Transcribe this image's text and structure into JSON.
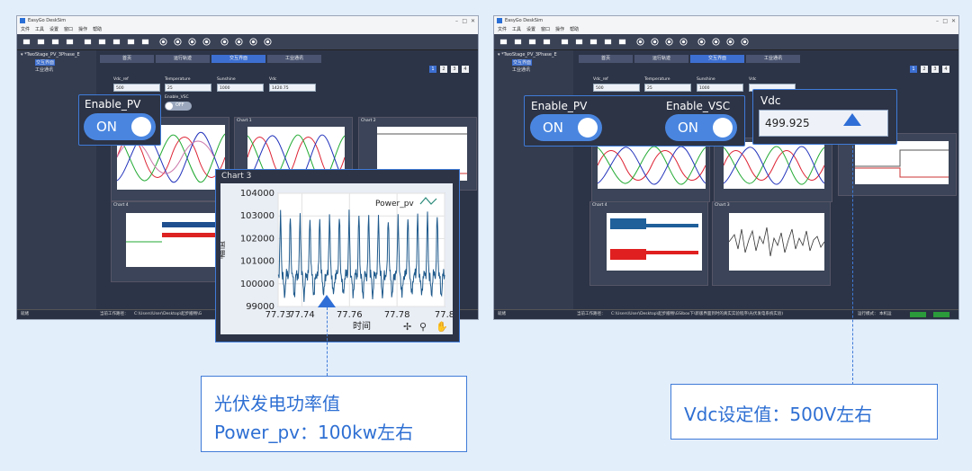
{
  "app": {
    "title": "EasyGo DeskSim",
    "menus": [
      "文件",
      "工具",
      "设置",
      "窗口",
      "操作",
      "帮助"
    ]
  },
  "left": {
    "project": "*TwoStage_PV_3Phase_E",
    "tree_children": [
      "交互界面",
      "工业通讯"
    ],
    "tabs": [
      {
        "label": "首页"
      },
      {
        "label": "运行轨迹"
      },
      {
        "label": "交互界面"
      },
      {
        "label": "工业通讯"
      }
    ],
    "pages": [
      "1",
      "2",
      "3",
      "4"
    ],
    "fields": [
      {
        "label": "Vdc_ref",
        "value": "500"
      },
      {
        "label": "Temperature",
        "value": "25"
      },
      {
        "label": "Sunshine",
        "value": "1000"
      },
      {
        "label": "Vdc",
        "value": "1420.75"
      }
    ],
    "enable_vsc_label": "Enable_VSC",
    "enable_vsc_state": "OFF",
    "chart_titles": [
      "Chart 1",
      "Chart 2",
      "Chart 4"
    ],
    "status_left": "就绪",
    "status_path_label": "当前工作路径：",
    "status_path": "C:\\Users\\User\\Desktop\\起步搬畅\\G"
  },
  "right": {
    "project": "*TwoStage_PV_3Phase_E",
    "tree_children": [
      "交互界面",
      "工业通讯"
    ],
    "tabs": [
      {
        "label": "首页"
      },
      {
        "label": "运行轨迹"
      },
      {
        "label": "交互界面"
      },
      {
        "label": "工业通讯"
      }
    ],
    "pages": [
      "1",
      "2",
      "3",
      "4"
    ],
    "fields": [
      {
        "label": "Vdc_ref",
        "value": "500"
      },
      {
        "label": "Temperature",
        "value": "25"
      },
      {
        "label": "Sunshine",
        "value": "1000"
      },
      {
        "label": "Vdc",
        "value": ""
      }
    ],
    "chart_titles": [
      "Chart 4",
      "Chart 3"
    ],
    "status_left": "就绪",
    "status_path_label": "当前工作路径：",
    "status_path": "C:\\Users\\User\\Desktop\\起步搬畅\\GSlbox下\\新版界面到时的真实实验程序\\光伏发电系统实验)",
    "status_mode": "运行模式：",
    "status_mode_value": "本机运",
    "status_ok1": "",
    "status_ok2": ""
  },
  "callouts": {
    "enable_pv_label": "Enable_PV",
    "enable_pv_state": "ON",
    "enable_vsc_label": "Enable_VSC",
    "enable_vsc_state": "ON",
    "vdc_label": "Vdc",
    "vdc_value": "499.925"
  },
  "notes": {
    "left_line1": "光伏发电功率值",
    "left_line2": "Power_pv：100kw左右",
    "right_line1": "Vdc设定值：500V左右"
  },
  "chart_data": {
    "type": "line",
    "title": "Chart 3",
    "xlabel": "时间",
    "ylabel": "幅值",
    "series": [
      {
        "name": "Power_pv"
      }
    ],
    "x_ticks": [
      "77.73",
      "77.74",
      "77.76",
      "77.78",
      "77.8"
    ],
    "y_ticks": [
      "99000",
      "100000",
      "101000",
      "102000",
      "103000",
      "104000"
    ],
    "xlim": [
      77.73,
      77.8
    ],
    "ylim": [
      99000,
      104000
    ],
    "grid": true,
    "legend": "top-right"
  },
  "colors": {
    "accent": "#3f7bd8",
    "note_text": "#2e6fd3",
    "trace": "#1f5a8c"
  }
}
